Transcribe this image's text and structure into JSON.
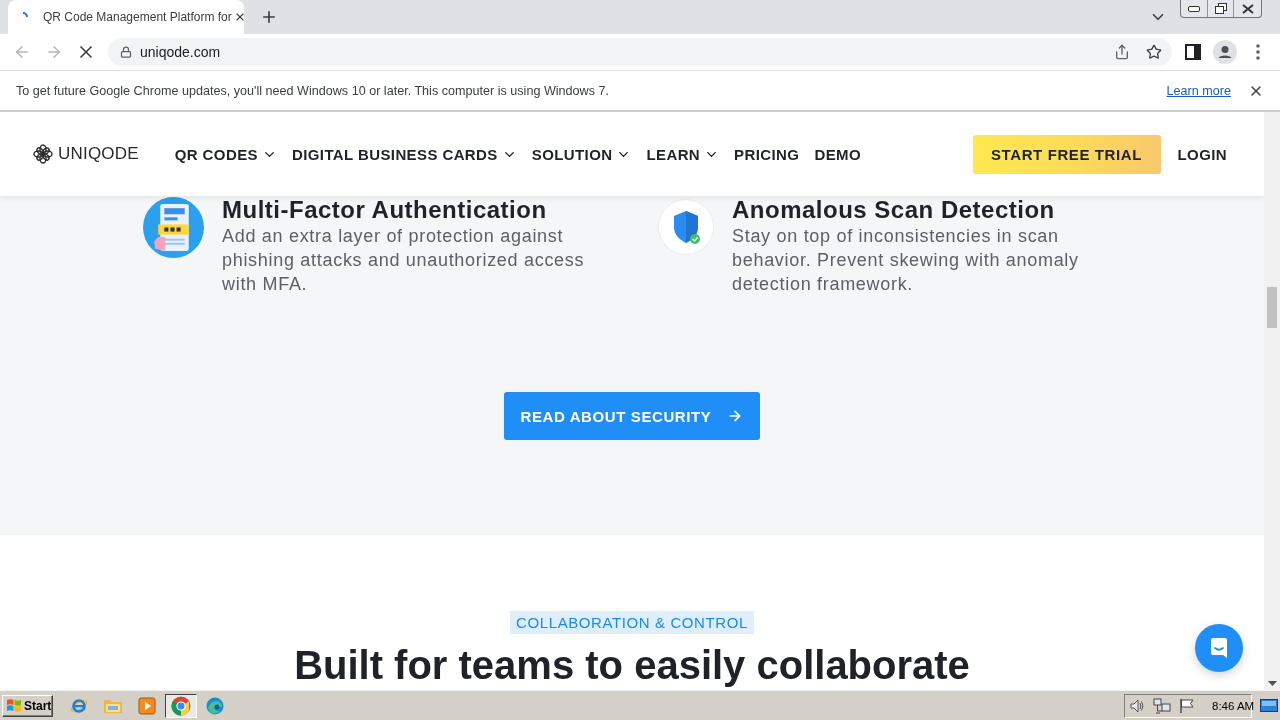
{
  "browser": {
    "tabs": [
      {
        "title": "QR Code Management Platform for",
        "selected": true
      }
    ],
    "loading": true,
    "toolbar": {
      "back_disabled": true,
      "forward_disabled": true
    },
    "address": "uniqode.com",
    "infobar": {
      "message": "To get future Google Chrome updates, you'll need Windows 10 or later. This computer is using Windows 7.",
      "link": "Learn more"
    }
  },
  "site_nav": {
    "logo": "UNIQODE",
    "items": [
      {
        "label": "QR CODES",
        "dropdown": true
      },
      {
        "label": "DIGITAL BUSINESS CARDS",
        "dropdown": true
      },
      {
        "label": "SOLUTION",
        "dropdown": true
      },
      {
        "label": "LEARN",
        "dropdown": true
      },
      {
        "label": "PRICING",
        "dropdown": false
      },
      {
        "label": "DEMO",
        "dropdown": false
      }
    ],
    "trial_button": "START FREE TRIAL",
    "login": "LOGIN"
  },
  "features": [
    {
      "kind": "keypad",
      "title": "Multi-Factor Authentication",
      "description": "Add an extra layer of protection against phishing attacks and unauthorized access with MFA."
    },
    {
      "kind": "shield",
      "title": "Anomalous Scan Detection",
      "description": "Stay on top of inconsistencies in scan behavior. Prevent skewing with anomaly detection framework."
    }
  ],
  "security_button": "READ ABOUT SECURITY",
  "collaboration": {
    "eyebrow": "COLLABORATION & CONTROL",
    "heading": "Built for teams to easily collaborate"
  },
  "taskbar": {
    "start": "Start",
    "apps": [
      {
        "kind": "ie",
        "selected": false
      },
      {
        "kind": "folder",
        "selected": false
      },
      {
        "kind": "media",
        "selected": false
      },
      {
        "kind": "chrome",
        "selected": true
      },
      {
        "kind": "edge",
        "selected": false
      }
    ],
    "clock": "8:46 AM"
  }
}
